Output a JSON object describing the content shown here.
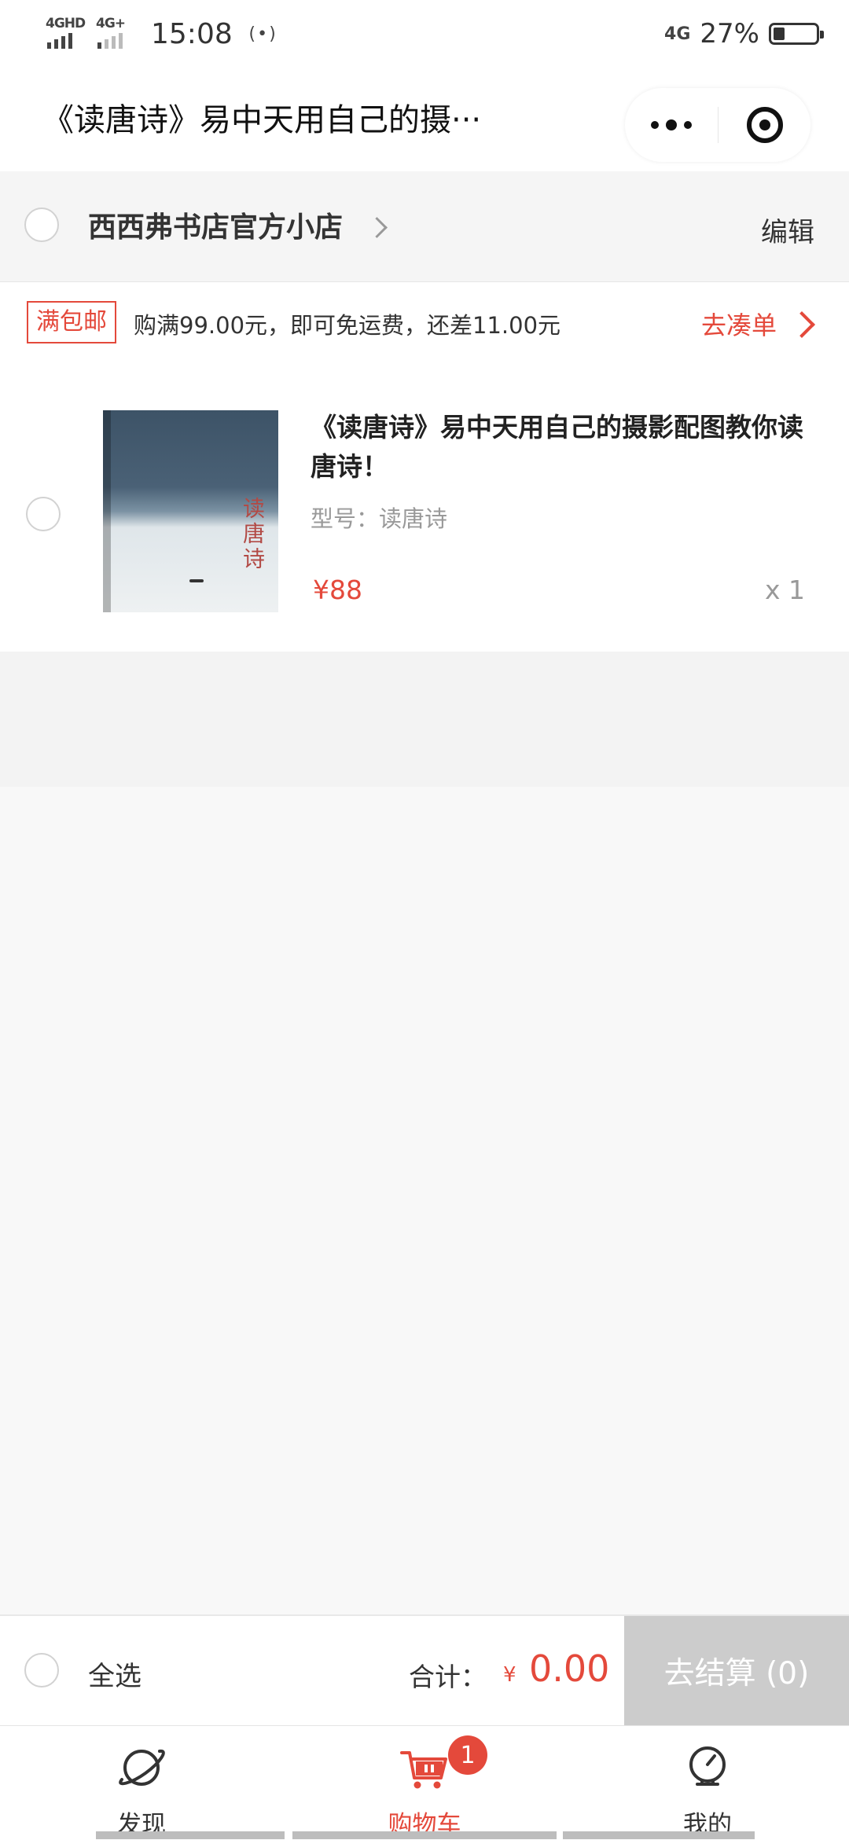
{
  "status_bar": {
    "net1": "4GHD",
    "net2": "4G+",
    "time": "15:08",
    "hotspot": "(•)",
    "net_right": "4G",
    "battery_pct": "27%",
    "battery_level": 0.27
  },
  "title_bar": {
    "title": "《读唐诗》易中天用自己的摄···",
    "more_icon": "more-dots-icon",
    "close_icon": "miniprogram-close-icon"
  },
  "store": {
    "name": "西西弗书店官方小店",
    "edit_label": "编辑"
  },
  "promo": {
    "tag": "满包邮",
    "text": "购满99.00元，即可免运费，还差11.00元",
    "link": "去凑单"
  },
  "cart_item": {
    "title": "《读唐诗》易中天用自己的摄影配图教你读唐诗！",
    "spec": "型号：读唐诗",
    "price": "¥88",
    "qty": "x 1",
    "cover_title": "读唐诗"
  },
  "checkout": {
    "select_all": "全选",
    "total_label": "合计：",
    "currency": "¥",
    "total_value": "0.00",
    "button": "去结算 (0)"
  },
  "tabs": [
    {
      "label": "发现",
      "icon": "planet-icon",
      "active": false
    },
    {
      "label": "购物车",
      "icon": "cart-icon",
      "active": true,
      "badge": "1"
    },
    {
      "label": "我的",
      "icon": "profile-icon",
      "active": false
    }
  ],
  "colors": {
    "accent": "#e4493b",
    "disabled_button": "#cccccc"
  }
}
